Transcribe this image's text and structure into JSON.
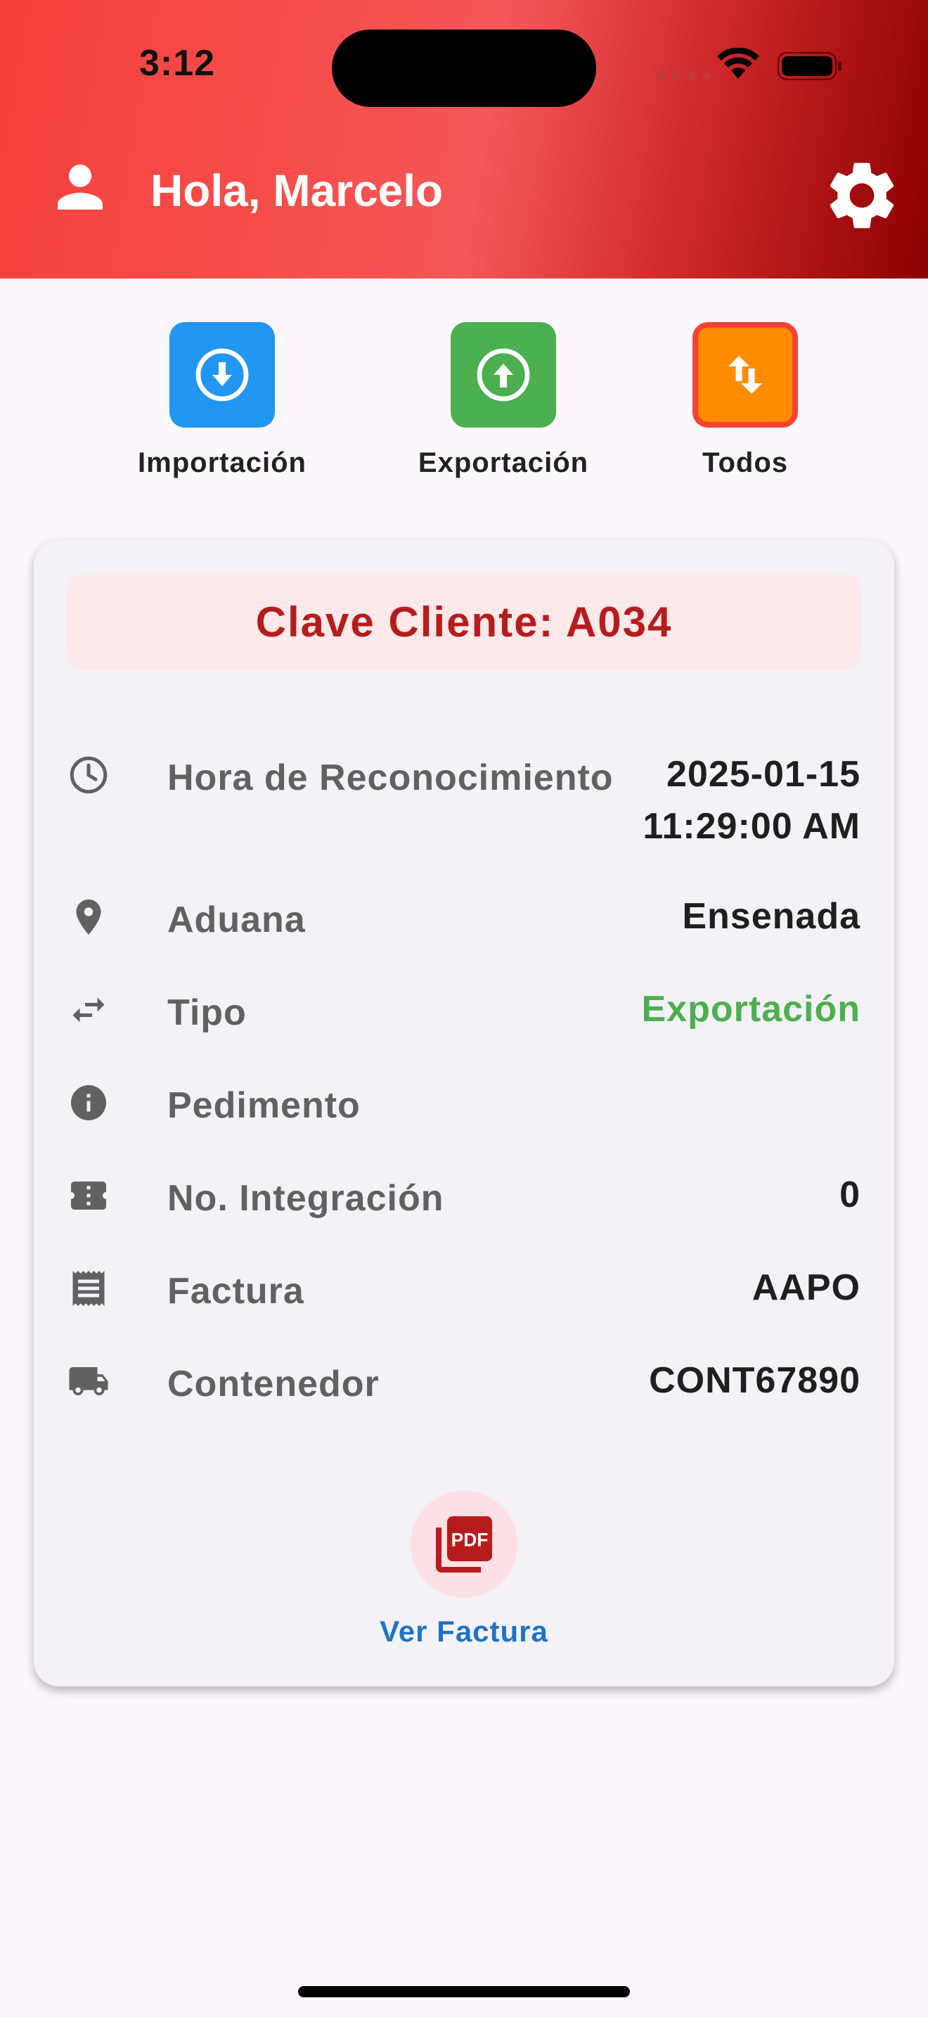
{
  "status_bar": {
    "time": "3:12"
  },
  "header": {
    "greeting": "Hola, Marcelo"
  },
  "filters": [
    {
      "label": "Importación",
      "color": "#2196f3",
      "icon": "arrow-down-circle-icon"
    },
    {
      "label": "Exportación",
      "color": "#4caf50",
      "icon": "arrow-up-circle-icon"
    },
    {
      "label": "Todos",
      "color": "#ff8c00",
      "icon": "swap-vertical-icon",
      "selected": true
    }
  ],
  "card": {
    "client_key": "Clave Cliente: A034",
    "rows": [
      {
        "icon": "clock-icon",
        "label": "Hora de Reconocimiento",
        "value_line1": "2025-01-15",
        "value_line2": "11:29:00 AM"
      },
      {
        "icon": "location-pin-icon",
        "label": "Aduana",
        "value": "Ensenada"
      },
      {
        "icon": "swap-horizontal-icon",
        "label": "Tipo",
        "value": "Exportación",
        "value_color": "#4caf50"
      },
      {
        "icon": "info-icon",
        "label": "Pedimento",
        "value": ""
      },
      {
        "icon": "ticket-icon",
        "label": "No. Integración",
        "value": "0"
      },
      {
        "icon": "receipt-icon",
        "label": "Factura",
        "value": "AAPO"
      },
      {
        "icon": "truck-icon",
        "label": "Contenedor",
        "value": "CONT67890"
      }
    ],
    "pdf_button": {
      "label": "Ver Factura",
      "icon": "pdf-icon"
    }
  },
  "colors": {
    "header_start": "#f4403a",
    "header_end": "#8c0000",
    "accent_red": "#b71c1c",
    "link_blue": "#1e73c8"
  }
}
